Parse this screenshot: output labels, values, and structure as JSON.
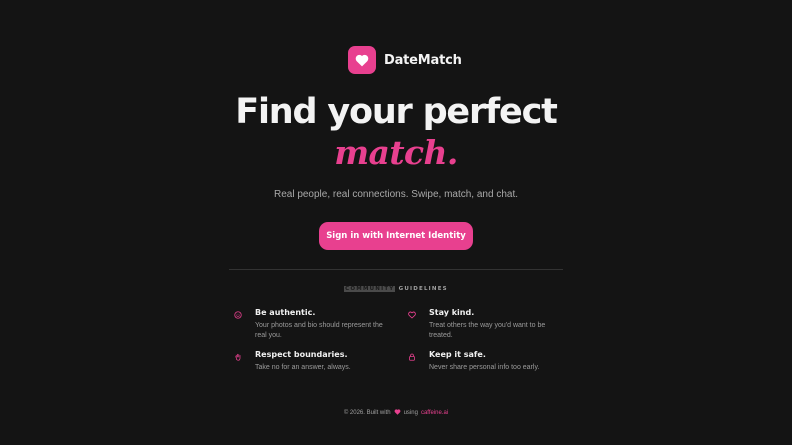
{
  "brand": {
    "name": "DateMatch",
    "logo_icon": "heart-icon",
    "accent_color": "#e8408f"
  },
  "hero": {
    "headline": "Find your perfect",
    "accent": "match.",
    "subtitle": "Real people, real connections. Swipe, match, and chat."
  },
  "cta": {
    "label": "Sign in with Internet Identity"
  },
  "guidelines": {
    "label_highlight": "COMMUNITY",
    "label_rest": " GUIDELINES",
    "items": [
      {
        "icon": "smile-icon",
        "title": "Be authentic.",
        "description": "Your photos and bio should represent the real you."
      },
      {
        "icon": "heart-outline-icon",
        "title": "Stay kind.",
        "description": "Treat others the way you'd want to be treated."
      },
      {
        "icon": "hand-icon",
        "title": "Respect boundaries.",
        "description": "Take no for an answer, always."
      },
      {
        "icon": "lock-icon",
        "title": "Keep it safe.",
        "description": "Never share personal info too early."
      }
    ]
  },
  "footer": {
    "prefix": "© 2026. Built with",
    "middle": "using",
    "link": "caffeine.ai",
    "icon": "heart-icon"
  }
}
